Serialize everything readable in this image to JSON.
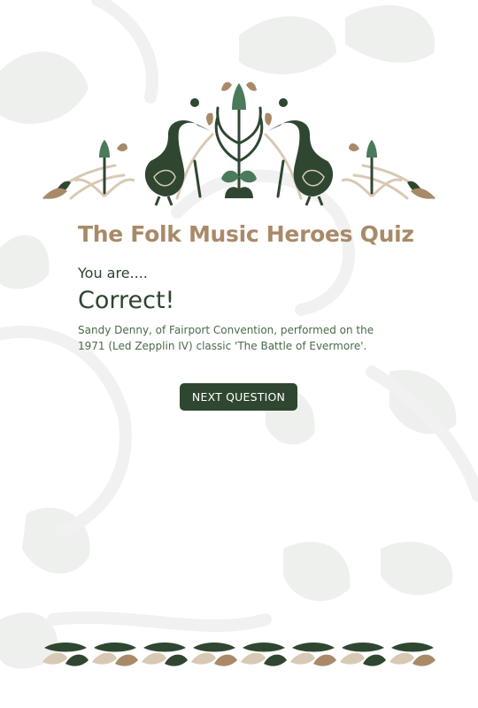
{
  "quiz": {
    "title": "The Folk Music Heroes Quiz",
    "intro": "You are....",
    "result": "Correct!",
    "explanation": "Sandy Denny, of Fairport Convention, performed on the 1971 (Led Zepplin IV) classic 'The Battle of Evermore'."
  },
  "actions": {
    "next_label": "NEXT QUESTION"
  },
  "colors": {
    "dark_green": "#2f4731",
    "tan": "#a98a68",
    "beige": "#d8c9b4",
    "bg_pattern": "#eceeec"
  },
  "decorations": {
    "top_ornament": "folk-herons-and-plants-ornament",
    "bottom_border": "folk-leaf-border",
    "background": "faded-floral-pattern"
  }
}
